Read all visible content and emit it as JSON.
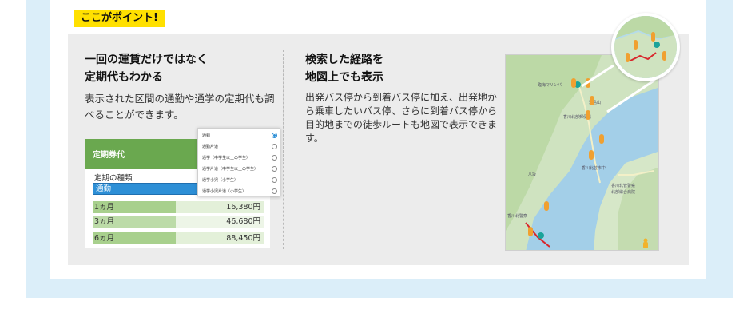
{
  "badge": "ここがポイント!",
  "left": {
    "title_line1": "一回の運賃だけではなく",
    "title_line2": "定期代もわかる",
    "desc": "表示された区間の通勤や通学の定期代も調べることができます。"
  },
  "fare_ui": {
    "header": "定期券代",
    "type_label": "定期の種類",
    "selected": "通勤",
    "rows": [
      {
        "period": "1ヵ月",
        "price": "16,380円"
      },
      {
        "period": "3ヵ月",
        "price": "46,680円"
      },
      {
        "period": "6ヵ月",
        "price": "88,450円"
      }
    ],
    "options": [
      "通勤",
      "通勤片道",
      "通学（中学生以上の学生）",
      "通学片道（中学生以上の学生）",
      "通学小児（小学生）",
      "通学小児片道（小学生）"
    ]
  },
  "right": {
    "title_line1": "検索した経路を",
    "title_line2": "地図上でも表示",
    "desc": "出発バス停から到着バス停に加え、出発地から乗車したいバス停、さらに到着バス停から目的地までの徒歩ルートも地図で表示できます。"
  },
  "map": {
    "labels": [
      "臨海マリンパ",
      "津島山",
      "香川北部郵便局",
      "香川北芸市中",
      "香川北管警察",
      "北部総合病院",
      "香川北警察",
      "八坂"
    ]
  },
  "colors": {
    "badge_bg": "#ffe000",
    "panel_bg": "#ececec",
    "outer_bg": "#dbeef9",
    "green": "#6aa84f",
    "select_blue": "#2d8fd6",
    "route_red": "#d9262c",
    "pin_orange": "#f0a030"
  }
}
